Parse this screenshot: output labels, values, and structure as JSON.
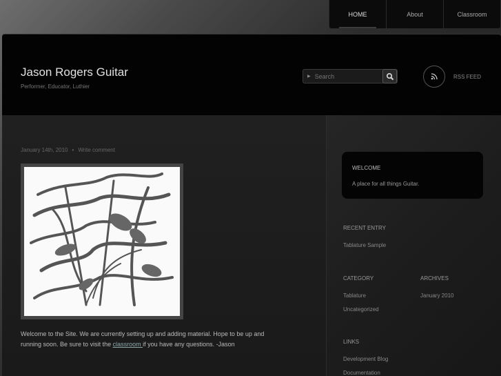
{
  "nav": {
    "items": [
      {
        "label": "HOME"
      },
      {
        "label": "About"
      },
      {
        "label": "Classroom"
      }
    ]
  },
  "header": {
    "title": "Jason Rogers Guitar",
    "tagline": "Performer, Educator, Luthier",
    "search_placeholder": "Search",
    "rss_label": "RSS FEED"
  },
  "post": {
    "date": "January 14th, 2010",
    "comment_link": "Write comment",
    "text_before_link": "Welcome to the Site. We are currently setting up and adding material. Hope to be up and running soon. Be sure to visit the ",
    "link_text": "classroom ",
    "text_after_link": "if you have any questions.   -Jason"
  },
  "sidebar": {
    "welcome_heading": "WELCOME",
    "welcome_text": "A place for all things Guitar.",
    "recent_heading": "RECENT ENTRY",
    "recent_items": [
      "Tablature Sample"
    ],
    "category_heading": "CATEGORY",
    "categories": [
      "Tablature",
      "Uncategorized"
    ],
    "archives_heading": "ARCHIVES",
    "archives": [
      "January 2010"
    ],
    "links_heading": "LINKS",
    "links": [
      "Development Blog",
      "Documentation"
    ]
  },
  "colors": {
    "background": "#2c2c2c",
    "header": "#030303",
    "link": "#8fa9a9"
  }
}
